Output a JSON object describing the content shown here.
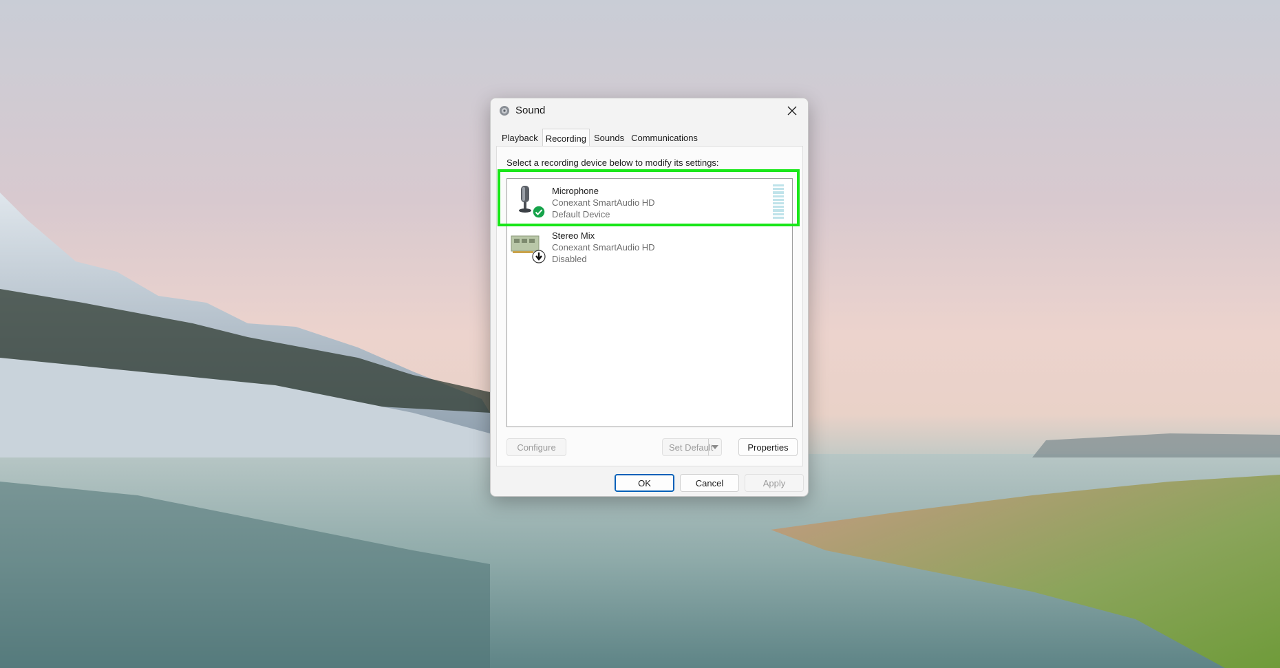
{
  "dialog": {
    "title": "Sound",
    "tabs": [
      {
        "label": "Playback"
      },
      {
        "label": "Recording"
      },
      {
        "label": "Sounds"
      },
      {
        "label": "Communications"
      }
    ],
    "active_tab": "Recording",
    "instruction": "Select a recording device below to modify its settings:",
    "devices": [
      {
        "name": "Microphone",
        "driver": "Conexant SmartAudio HD",
        "status": "Default Device",
        "icon": "microphone-icon",
        "badge": "default-check-icon",
        "selected": true
      },
      {
        "name": "Stereo Mix",
        "driver": "Conexant SmartAudio HD",
        "status": "Disabled",
        "icon": "sound-card-icon",
        "badge": "disabled-arrow-icon",
        "selected": false
      }
    ],
    "buttons": {
      "configure": "Configure",
      "set_default": "Set Default",
      "properties": "Properties",
      "ok": "OK",
      "cancel": "Cancel",
      "apply": "Apply"
    }
  },
  "colors": {
    "highlight": "#19e619",
    "default_badge": "#16a34a",
    "accent": "#005fb8"
  }
}
